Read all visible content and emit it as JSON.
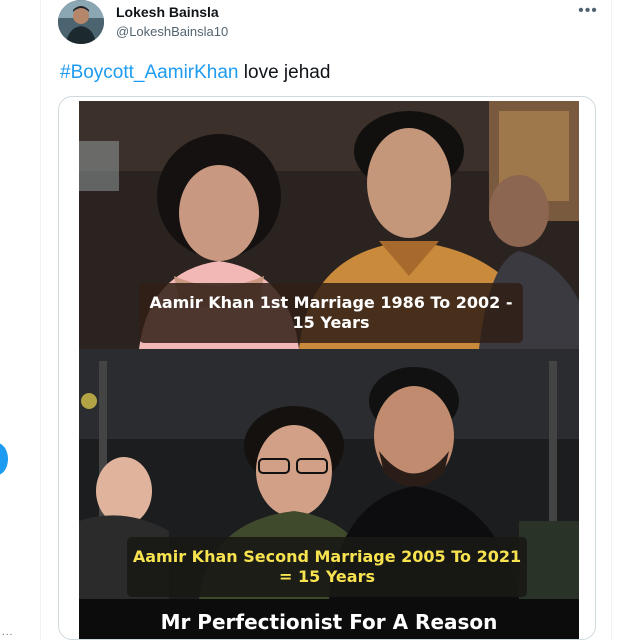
{
  "tweet": {
    "author": {
      "display_name": "Lokesh Bainsla",
      "handle": "@LokeshBainsla10",
      "avatar_icon": "profile-photo"
    },
    "more_icon": "more-horizontal-icon",
    "text": {
      "hashtag": "#Boycott_AamirKhan",
      "rest": " love jehad"
    },
    "media": {
      "caption_top": "Aamir Khan 1st Marriage 1986 To 2002 - 15 Years",
      "caption_bottom": "Aamir Khan Second Marriage 2005 To 2021 = 15 Years",
      "banner": "Mr Perfectionist For A Reason"
    }
  },
  "sidebar_edge": {
    "dots": "...",
    "accent_color": "#1d9bf0"
  },
  "colors": {
    "link": "#1d9bf0",
    "secondary_text": "#536471",
    "caption_bottom_text": "#f7e24f"
  }
}
